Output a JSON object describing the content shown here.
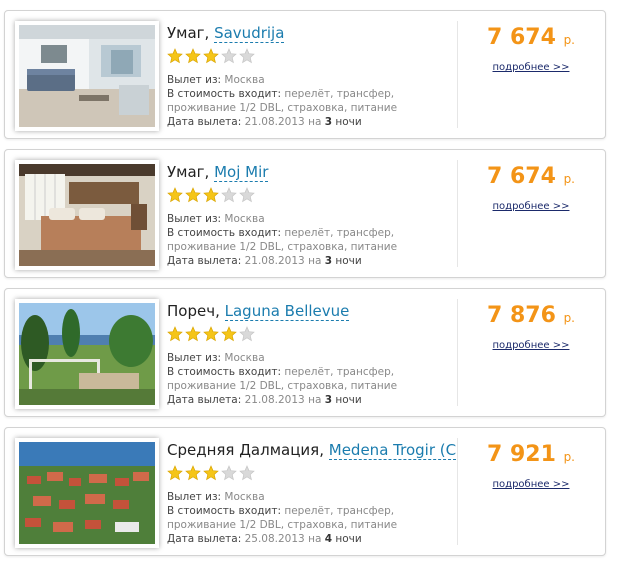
{
  "offers": [
    {
      "city": "Умаг,",
      "hotel": "Savudrija",
      "stars": 3,
      "departure_label": "Вылет из:",
      "departure_city": "Москва",
      "includes_label": "В стоимость входит:",
      "includes_line1": "перелёт, трансфер,",
      "includes_line2": "проживание 1/2 DBL, страховка, питание",
      "date_label": "Дата вылета:",
      "date": "21.08.2013",
      "on": "на",
      "nights_count": "3",
      "nights_word": "ночи",
      "price": "7 674",
      "currency": "р.",
      "more": "подробнее >>",
      "photo": "apartment-living-room"
    },
    {
      "city": "Умаг,",
      "hotel": "Moj Mir",
      "stars": 3,
      "departure_label": "Вылет из:",
      "departure_city": "Москва",
      "includes_label": "В стоимость входит:",
      "includes_line1": "перелёт, трансфер,",
      "includes_line2": "проживание 1/2 DBL, страховка, питание",
      "date_label": "Дата вылета:",
      "date": "21.08.2013",
      "on": "на",
      "nights_count": "3",
      "nights_word": "ночи",
      "price": "7 674",
      "currency": "р.",
      "more": "подробнее >>",
      "photo": "hotel-bedroom"
    },
    {
      "city": "Пореч,",
      "hotel": "Laguna Bellevue",
      "stars": 4,
      "departure_label": "Вылет из:",
      "departure_city": "Москва",
      "includes_label": "В стоимость входит:",
      "includes_line1": "перелёт, трансфер,",
      "includes_line2": "проживание 1/2 DBL, страховка, питание",
      "date_label": "Дата вылета:",
      "date": "21.08.2013",
      "on": "на",
      "nights_count": "3",
      "nights_word": "ночи",
      "price": "7 876",
      "currency": "р.",
      "more": "подробнее >>",
      "photo": "garden-with-trees-and-sea"
    },
    {
      "city": "Средняя Далмация,",
      "hotel": "Medena Trogir (C",
      "stars": 3,
      "departure_label": "Вылет из:",
      "departure_city": "Москва",
      "includes_label": "В стоимость входит:",
      "includes_line1": "перелёт, трансфер,",
      "includes_line2": "проживание 1/2 DBL, страховка, питание",
      "date_label": "Дата вылета:",
      "date": "25.08.2013",
      "on": "на",
      "nights_count": "4",
      "nights_word": "ночи",
      "price": "7 921",
      "currency": "р.",
      "more": "подробнее >>",
      "photo": "coastal-resort-aerial"
    }
  ],
  "colors": {
    "price": "#f39417",
    "hotel_link": "#1b7cae",
    "star_filled": "#f5c518",
    "star_empty": "#d9d9d9"
  },
  "star_total": 5
}
